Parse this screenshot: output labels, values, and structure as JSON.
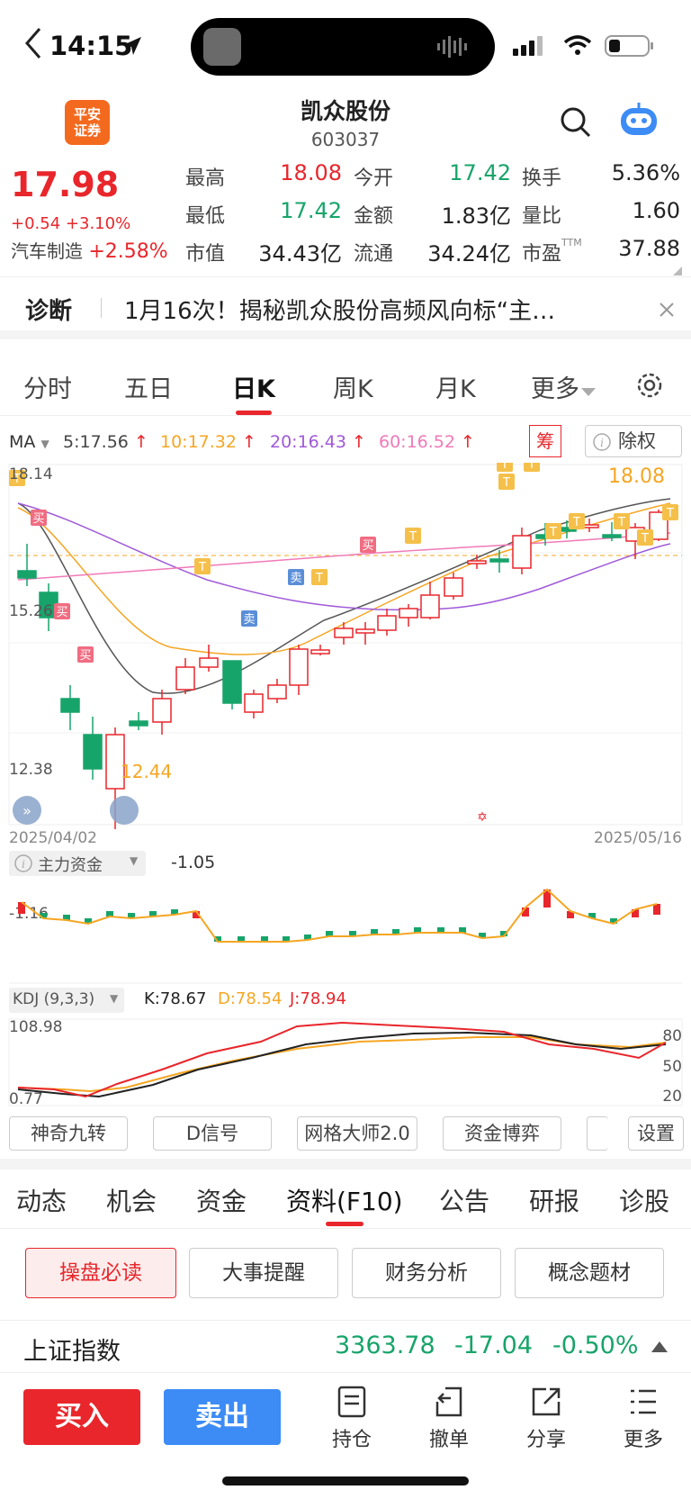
{
  "status": {
    "time": "14:15"
  },
  "header": {
    "logo_line1": "平安",
    "logo_line2": "证券",
    "name": "凯众股份",
    "code": "603037"
  },
  "quote": {
    "price": "17.98",
    "change": "+0.54",
    "change_pct": "+3.10%",
    "sector": "汽车制造",
    "sector_pct": "+2.58%",
    "high_label": "最高",
    "high": "18.08",
    "open_label": "今开",
    "open": "17.42",
    "turnover_label": "换手",
    "turnover": "5.36%",
    "low_label": "最低",
    "low": "17.42",
    "amount_label": "金额",
    "amount": "1.83亿",
    "vol_ratio_label": "量比",
    "vol_ratio": "1.60",
    "mcap_label": "市值",
    "mcap": "34.43亿",
    "float_label": "流通",
    "float": "34.24亿",
    "pe_label": "市盈",
    "pe_sup": "TTM",
    "pe": "37.88"
  },
  "diagnosis": {
    "label": "诊断",
    "text": "1月16次！揭秘凯众股份高频风向标“主…"
  },
  "chart_tabs": [
    "分时",
    "五日",
    "日K",
    "周K",
    "月K",
    "更多"
  ],
  "active_chart_tab": "日K",
  "ma": {
    "label": "MA",
    "ma5": "5:17.56",
    "ma10": "10:17.32",
    "ma20": "20:16.43",
    "ma60": "60:16.52",
    "chip": "筹",
    "exright": "除权"
  },
  "kchart": {
    "y_top": "18.14",
    "y_mid": "15.26",
    "y_low": "12.38",
    "date_start": "2025/04/02",
    "date_end": "2025/05/16",
    "high_mark": "18.08",
    "low_mark": "12.44",
    "buy": "买",
    "sell": "卖",
    "t": "T"
  },
  "fund": {
    "label": "主力资金",
    "value": "-1.05",
    "axis": "-1.16"
  },
  "kdj": {
    "label": "KDJ (9,3,3)",
    "k": "K:78.67",
    "d": "D:78.54",
    "j": "J:78.94",
    "y_top": "108.98",
    "y_bottom": "0.77",
    "levels": [
      "80",
      "50",
      "20"
    ]
  },
  "tools": [
    "神奇九转",
    "D信号",
    "网格大师2.0",
    "资金博弈",
    "设置"
  ],
  "info_tabs": [
    "动态",
    "机会",
    "资金",
    "资料(F10)",
    "公告",
    "研报",
    "诊股"
  ],
  "active_info_tab": "资料(F10)",
  "pills": [
    "操盘必读",
    "大事提醒",
    "财务分析",
    "概念题材"
  ],
  "index": {
    "name": "上证指数",
    "value": "3363.78",
    "change": "-17.04",
    "pct": "-0.50%"
  },
  "bottom": {
    "buy": "买入",
    "sell": "卖出",
    "hold": "持仓",
    "cancel": "撤单",
    "share": "分享",
    "more": "更多"
  },
  "colors": {
    "up": "#e8262b",
    "down": "#17a46a",
    "accent": "#f36a1f",
    "buy_btn": "#e8262b",
    "sell_btn": "#3d8cf5",
    "ma5": "#444444",
    "ma10": "#f5a623",
    "ma20": "#a05ad8",
    "ma60": "#f07ab8"
  }
}
